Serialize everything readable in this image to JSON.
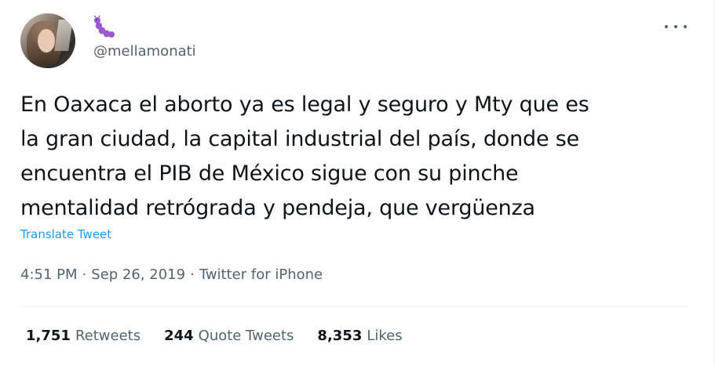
{
  "user": {
    "handle": "@mellamonati",
    "avatar_icon": "profile-photo",
    "badge_icon": "caterpillar-emoji"
  },
  "tweet": {
    "lines": [
      "En Oaxaca el aborto ya es legal y seguro y Mty que es",
      "la gran ciudad, la capital industrial del país, donde se",
      "encuentra el PIB de México sigue con su pinche",
      "mentalidad retrógrada y pendeja, que vergüenza"
    ],
    "translate_label": "Translate Tweet"
  },
  "meta": {
    "time": "4:51 PM",
    "separator": "·",
    "date": "Sep 26, 2019",
    "source": "Twitter for iPhone"
  },
  "stats": {
    "retweets_count": "1,751",
    "retweets_label": "Retweets",
    "quotes_count": "244",
    "quotes_label": "Quote Tweets",
    "likes_count": "8,353",
    "likes_label": "Likes"
  },
  "colors": {
    "text": "#0f1419",
    "secondary": "#536471",
    "link": "#1d9bf0",
    "badge": "#9b59d0"
  }
}
